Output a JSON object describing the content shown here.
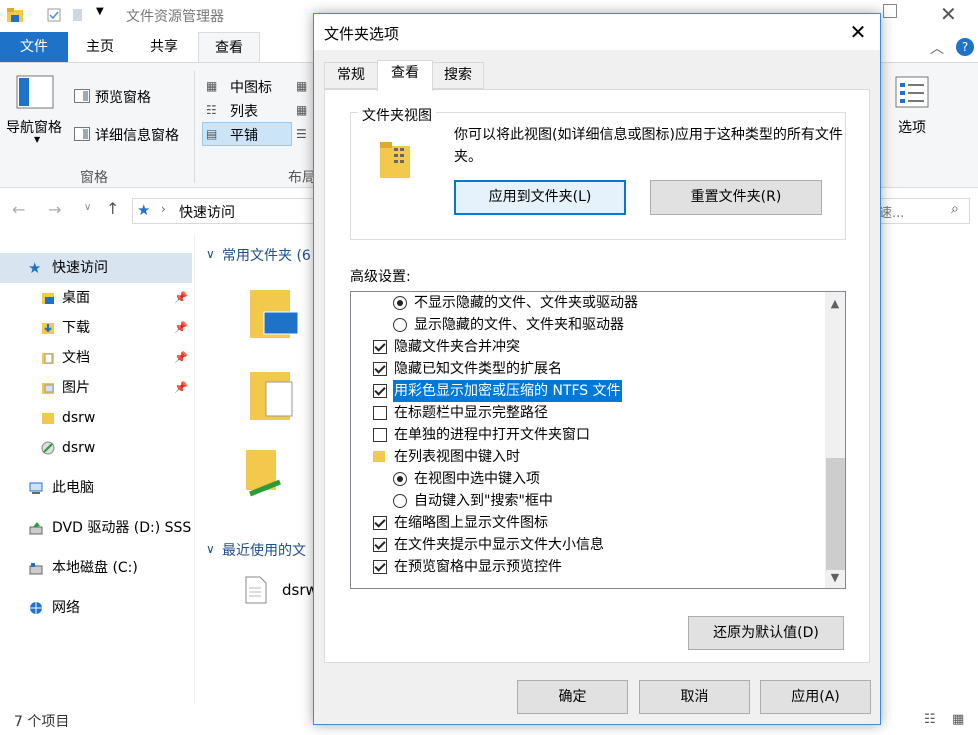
{
  "explorer": {
    "title": "文件资源管理器",
    "tabs": [
      "文件",
      "主页",
      "共享",
      "查看"
    ],
    "ribbon": {
      "nav_pane": "导航窗格",
      "preview_pane": "预览窗格",
      "details_pane": "详细信息窗格",
      "panes_group": "窗格",
      "medium_icons": "中图标",
      "list": "列表",
      "tiles": "平铺",
      "layout_group": "布局",
      "options": "选项"
    },
    "address": "快速访问",
    "search_placeholder": "搜\"快速...",
    "nav_items": [
      {
        "label": "快速访问"
      },
      {
        "label": "桌面"
      },
      {
        "label": "下载"
      },
      {
        "label": "文档"
      },
      {
        "label": "图片"
      },
      {
        "label": "dsrw"
      },
      {
        "label": "dsrw"
      },
      {
        "label": "此电脑"
      },
      {
        "label": "DVD 驱动器 (D:) SSS"
      },
      {
        "label": "本地磁盘 (C:)"
      },
      {
        "label": "网络"
      }
    ],
    "content": {
      "frequent_header": "常用文件夹 (6",
      "recent_header": "最近使用的文",
      "recent_file": "dsrw"
    },
    "status": "7 个项目"
  },
  "dialog": {
    "title": "文件夹选项",
    "tabs": [
      "常规",
      "查看",
      "搜索"
    ],
    "folder_views": {
      "title": "文件夹视图",
      "description": "你可以将此视图(如详细信息或图标)应用于这种类型的所有文件夹。",
      "apply_button": "应用到文件夹(L)",
      "reset_button": "重置文件夹(R)"
    },
    "advanced_label": "高级设置:",
    "advanced": [
      {
        "kind": "radio",
        "checked": true,
        "label": "不显示隐藏的文件、文件夹或驱动器",
        "indent": 1
      },
      {
        "kind": "radio",
        "checked": false,
        "label": "显示隐藏的文件、文件夹和驱动器",
        "indent": 1
      },
      {
        "kind": "check",
        "checked": true,
        "label": "隐藏文件夹合并冲突",
        "indent": 0
      },
      {
        "kind": "check",
        "checked": true,
        "label": "隐藏已知文件类型的扩展名",
        "indent": 0
      },
      {
        "kind": "check",
        "checked": true,
        "label": "用彩色显示加密或压缩的 NTFS 文件",
        "indent": 0,
        "selected": true
      },
      {
        "kind": "check",
        "checked": false,
        "label": "在标题栏中显示完整路径",
        "indent": 0
      },
      {
        "kind": "check",
        "checked": false,
        "label": "在单独的进程中打开文件夹窗口",
        "indent": 0
      },
      {
        "kind": "folder",
        "checked": false,
        "label": "在列表视图中键入时",
        "indent": 0
      },
      {
        "kind": "radio",
        "checked": true,
        "label": "在视图中选中键入项",
        "indent": 1
      },
      {
        "kind": "radio",
        "checked": false,
        "label": "自动键入到\"搜索\"框中",
        "indent": 1
      },
      {
        "kind": "check",
        "checked": true,
        "label": "在缩略图上显示文件图标",
        "indent": 0
      },
      {
        "kind": "check",
        "checked": true,
        "label": "在文件夹提示中显示文件大小信息",
        "indent": 0
      },
      {
        "kind": "check",
        "checked": true,
        "label": "在预览窗格中显示预览控件",
        "indent": 0
      }
    ],
    "restore_button": "还原为默认值(D)",
    "ok_button": "确定",
    "cancel_button": "取消",
    "apply_button": "应用(A)"
  },
  "colors": {
    "accent": "#0078d7",
    "file_tab": "#1e73c9",
    "folder": "#f2c94c"
  }
}
